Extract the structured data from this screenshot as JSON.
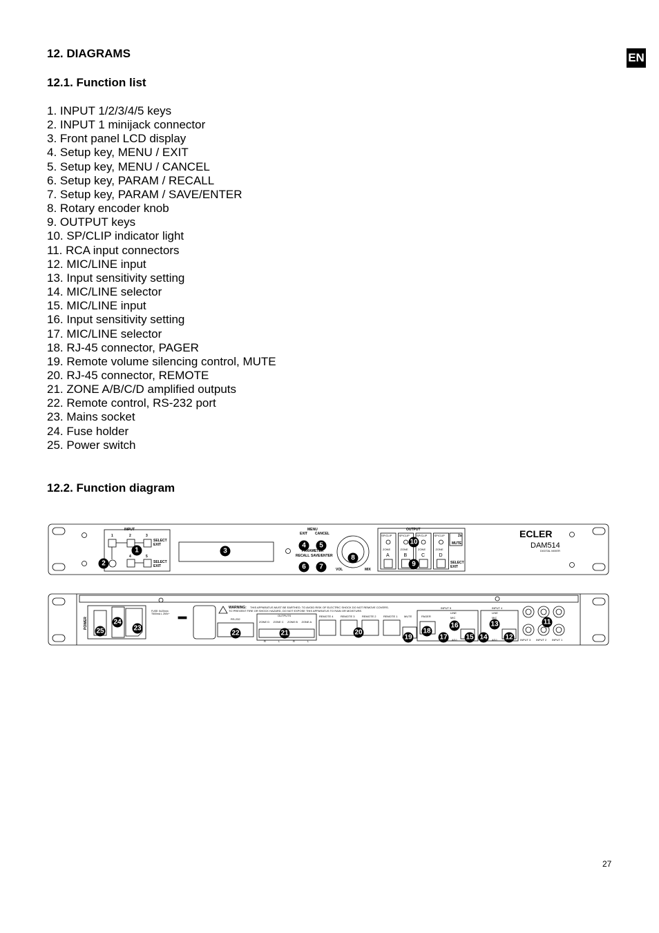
{
  "language_badge": "EN",
  "section_title": "12. DIAGRAMS",
  "function_list": {
    "title": "12.1. Function list",
    "items": [
      "1. INPUT 1/2/3/4/5 keys",
      "2. INPUT 1 minijack connector",
      "3. Front panel LCD display",
      "4. Setup key, MENU / EXIT",
      "5. Setup key, MENU / CANCEL",
      "6. Setup key, PARAM / RECALL",
      "7. Setup key, PARAM / SAVE/ENTER",
      "8. Rotary encoder knob",
      "9. OUTPUT keys",
      "10. SP/CLIP indicator light",
      "11. RCA input connectors",
      "12. MIC/LINE input",
      "13. Input sensitivity setting",
      "14. MIC/LINE selector",
      "15. MIC/LINE input",
      "16. Input sensitivity setting",
      "17. MIC/LINE selector",
      "18. RJ-45 connector, PAGER",
      "19. Remote volume silencing control, MUTE",
      "20. RJ-45 connector, REMOTE",
      "21. ZONE A/B/C/D amplified outputs",
      "22. Remote control, RS-232 port",
      "23. Mains socket",
      "24. Fuse holder",
      "25. Power switch"
    ]
  },
  "function_diagram": {
    "title": "12.2. Function diagram",
    "front": {
      "input_label": "INPUT",
      "keys": [
        "1",
        "2",
        "3",
        "4",
        "5"
      ],
      "select": "SELECT",
      "exit": "EXIT",
      "menu": "MENU",
      "cancel": "CANCEL",
      "parameter": "PARAMETER",
      "recall": "RECALL",
      "save_enter": "SAVE/ENTER",
      "vol": "VOL",
      "mix": "MIX",
      "output_label": "OUTPUT",
      "sp_clip": "SP/CLIP",
      "zone": "ZONE",
      "zones": [
        "A",
        "B",
        "C",
        "D"
      ],
      "mute": "MUTE",
      "mute_hold": "2s",
      "brand": "ECLER",
      "model": "DAM514",
      "model_sub": "DIGITAL MIXER"
    },
    "rear": {
      "power": "POWER",
      "fuse": [
        "FUSE: 5x20mm",
        "T500mA L 250V~"
      ],
      "warning_title": "WARNING:",
      "warning_line1": "THIS APPARATUS MUST BE EARTHED.  TO AVOID RISK OF ELECTRIC SHOCK DO NOT REMOVE COVERS.",
      "warning_line2": "TO PREVENT FIRE OR SHOCK HAZARD, DO NOT EXPOSE THIS APPARATUS TO RAIN OR MOISTURE.",
      "rs232": "RS-232",
      "outputs": "OUTPUTS",
      "out_zones": [
        "ZONE D",
        "ZONE C",
        "ZONE B",
        "ZONE A"
      ],
      "rl": [
        "R",
        "L",
        "R",
        "L"
      ],
      "remotes": [
        "REMOTE 4",
        "REMOTE 3",
        "REMOTE 2",
        "REMOTE 1"
      ],
      "mute": "MUTE",
      "pager": "PAGER",
      "input5": "INPUT 5",
      "input4": "INPUT 4",
      "line": "LINE",
      "mic": "MIC",
      "adj": "ADJ.",
      "rca_inputs": [
        "INPUT 3",
        "INPUT 2",
        "INPUT 1"
      ]
    },
    "callouts_front": [
      "1",
      "2",
      "3",
      "4",
      "5",
      "6",
      "7",
      "8",
      "9",
      "10"
    ],
    "callouts_rear": [
      "25",
      "24",
      "23",
      "22",
      "21",
      "20",
      "19",
      "18",
      "17",
      "16",
      "15",
      "14",
      "13",
      "12",
      "11"
    ]
  },
  "page_number": "27"
}
